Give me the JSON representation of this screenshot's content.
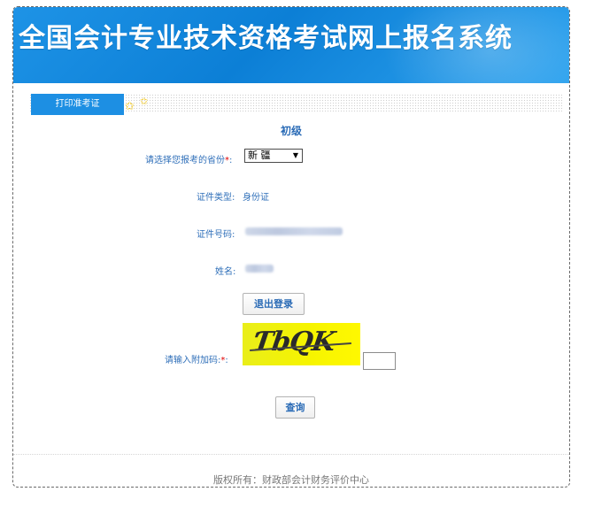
{
  "banner": {
    "title": "全国会计专业技术资格考试网上报名系统"
  },
  "tabs": [
    {
      "label": "打印准考证",
      "active": true
    }
  ],
  "level": "初级",
  "form": {
    "province_label": "请选择您报考的省份",
    "province_required": "*",
    "province_colon": ":",
    "province_value": "新 疆",
    "id_type_label": "证件类型:",
    "id_type_value": "身份证",
    "id_number_label": "证件号码:",
    "name_label": "姓名:",
    "logout_button": "退出登录",
    "captcha_label": "请输入附加码:",
    "captcha_required": "*",
    "captcha_colon": ":",
    "captcha_text": "ƬbQK",
    "query_button": "查询"
  },
  "footer": "版权所有：财政部会计财务评价中心",
  "colors": {
    "banner_blue": "#1a8de4",
    "tab_blue": "#1d8fe3",
    "label_blue": "#2f6fb9",
    "captcha_yellow": "#f6f400",
    "required_red": "#e00000"
  },
  "icons": {
    "star": "star-icon",
    "select_arrow": "chevron-down-icon"
  }
}
